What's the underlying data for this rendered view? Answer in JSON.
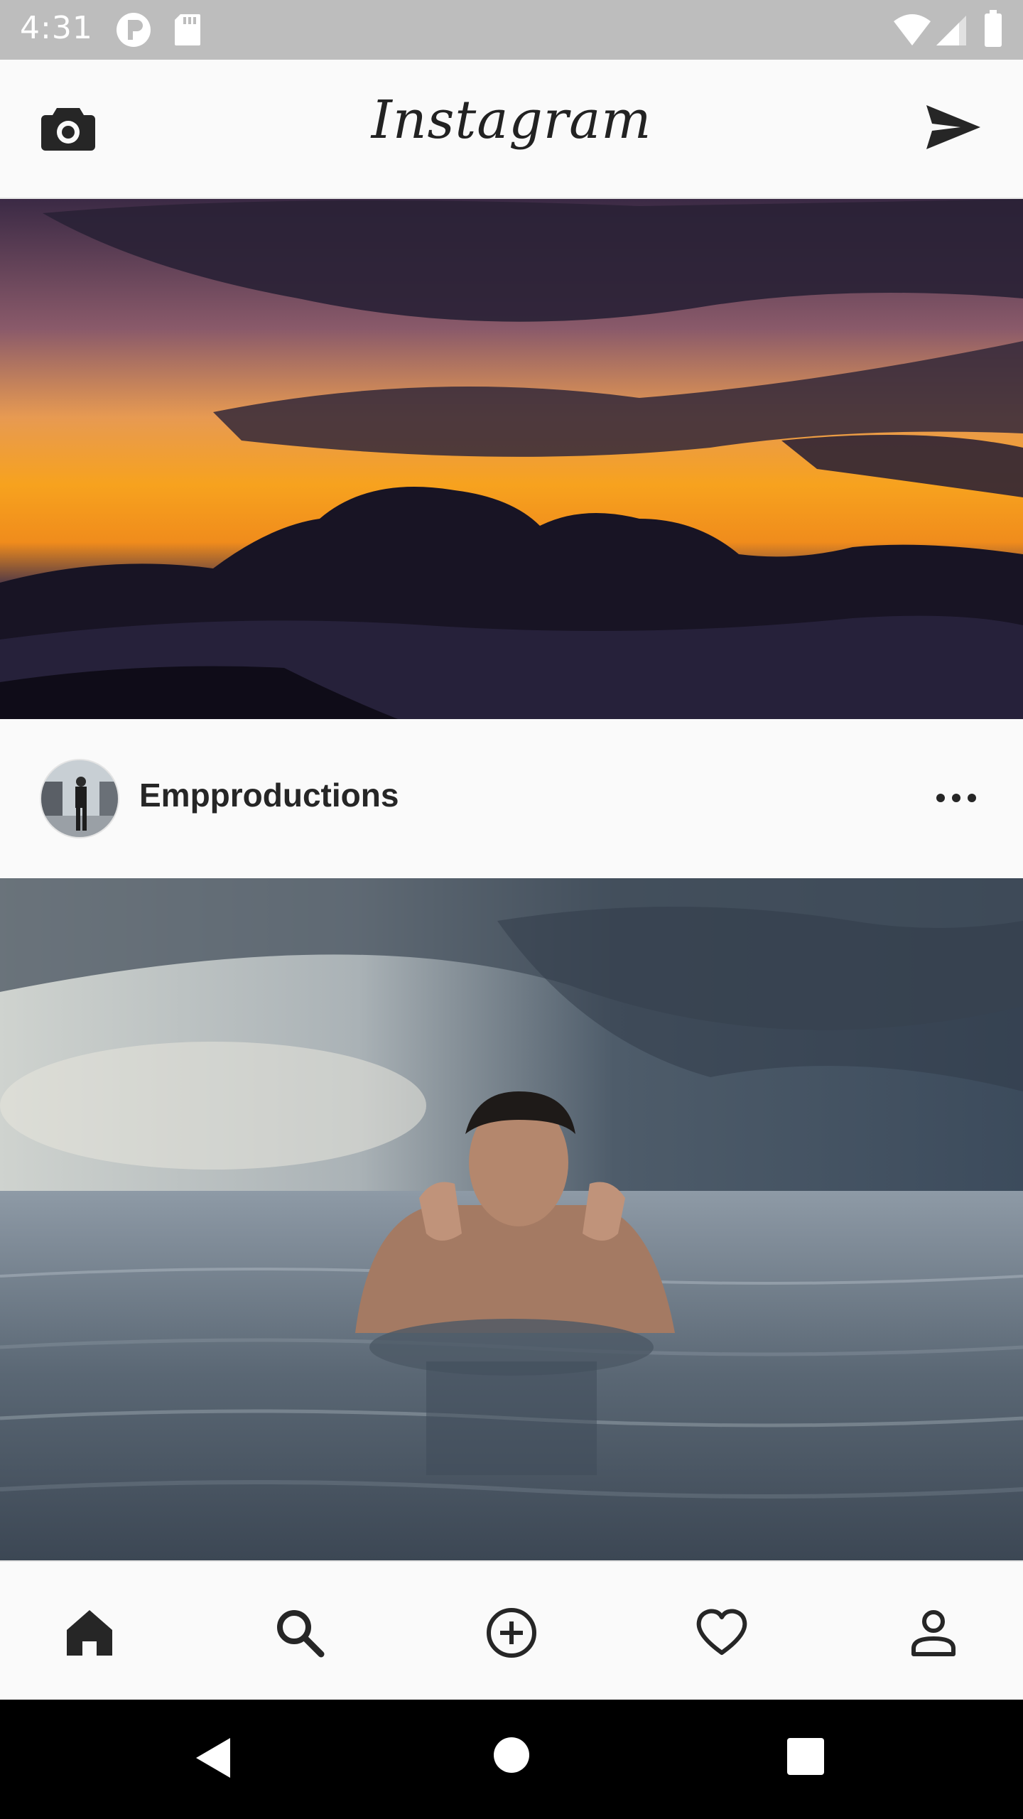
{
  "status_bar": {
    "time": "4:31",
    "left_icons": [
      "app-notification-icon",
      "sd-card-icon"
    ],
    "right_icons": [
      "wifi-icon",
      "cellular-signal-icon",
      "battery-icon"
    ]
  },
  "header": {
    "logo": "Instagram",
    "left_icon": "camera-icon",
    "right_icon": "direct-send-icon"
  },
  "post": {
    "username": "Empproductions",
    "more_icon": "more-options-icon"
  },
  "bottom_nav": {
    "items": [
      {
        "icon": "home-icon",
        "active": true
      },
      {
        "icon": "search-icon"
      },
      {
        "icon": "add-post-icon"
      },
      {
        "icon": "heart-icon"
      },
      {
        "icon": "profile-icon"
      }
    ]
  },
  "system_nav": {
    "items": [
      "back-icon",
      "home-circle-icon",
      "recents-icon"
    ]
  },
  "colors": {
    "status_bar": "#bdbdbd",
    "background": "#fafafa",
    "text": "#262626",
    "system_nav": "#000000"
  }
}
